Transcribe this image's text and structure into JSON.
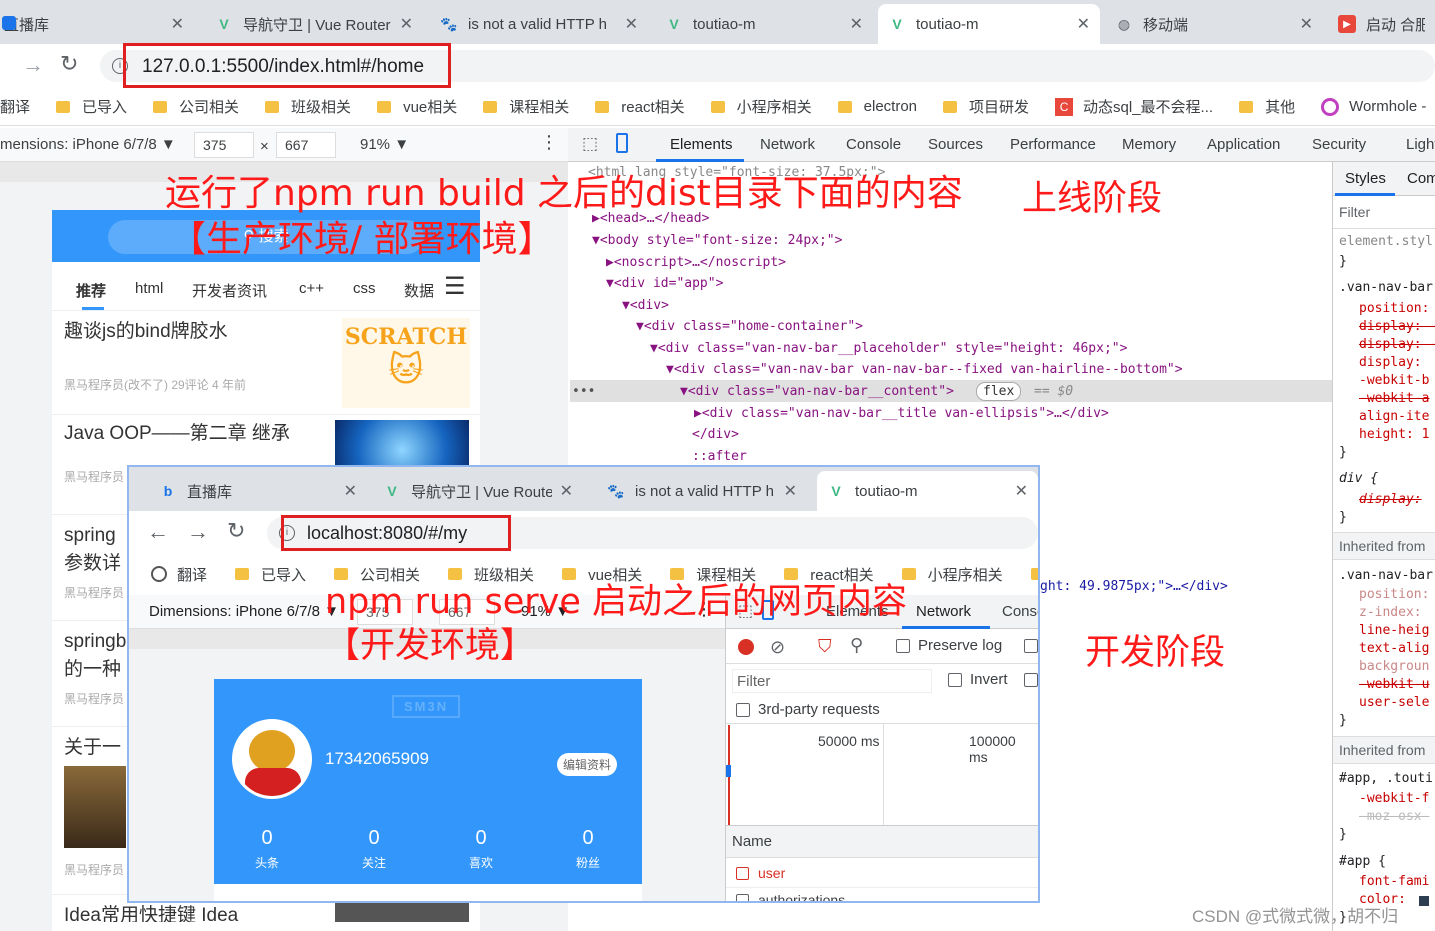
{
  "outer_browser": {
    "tabs": [
      {
        "title": "直播库",
        "icon": "bilibili-icon"
      },
      {
        "title": "导航守卫 | Vue Router",
        "icon": "vue-icon"
      },
      {
        "title": "is not a valid HTTP h",
        "icon": "baidu-icon"
      },
      {
        "title": "toutiao-m",
        "icon": "vue-icon"
      },
      {
        "title": "toutiao-m",
        "icon": "vue-icon"
      },
      {
        "title": "移动端",
        "icon": "globe-icon"
      },
      {
        "title": "启动 合肥",
        "icon": "video-icon"
      }
    ],
    "url": "127.0.0.1:5500/index.html#/home",
    "bookmarks": [
      "翻译",
      "已导入",
      "公司相关",
      "班级相关",
      "vue相关",
      "课程相关",
      "react相关",
      "小程序相关",
      "electron",
      "项目研发",
      "动态sql_最不会程...",
      "其他",
      "Wormhole -"
    ],
    "device_bar": {
      "device": "mensions: iPhone 6/7/8 ▼",
      "width": "375",
      "x": "×",
      "height": "667",
      "zoom": "91% ▼"
    },
    "devtools_tabs": [
      "Elements",
      "Network",
      "Console",
      "Sources",
      "Performance",
      "Memory",
      "Application",
      "Security",
      "Lighth"
    ],
    "styles_tabs": [
      "Styles",
      "Com"
    ]
  },
  "outer_page": {
    "search_label": "搜索",
    "channels": [
      "推荐",
      "html",
      "开发者资讯",
      "c++",
      "css",
      "数据"
    ],
    "articles": [
      {
        "title": "趣谈js的bind牌胶水",
        "meta": "黑马程序员(改不了) 29评论 4 年前"
      },
      {
        "title": "Java OOP——第二章 继承",
        "meta": "黑马程序员"
      },
      {
        "title": "spring",
        "title2": "参数详",
        "meta": "黑马程序员"
      },
      {
        "title": "springb",
        "title2": "的一种",
        "meta": "黑马程序员"
      },
      {
        "title": "关于一",
        "meta": "黑马程序员"
      },
      {
        "title": "Idea常用快捷键 Idea"
      }
    ],
    "scratch_label": "SCRATCH"
  },
  "dom_tree": [
    "<html lang style=\"font-size: 37.5px;\">",
    "▶<head>…</head>",
    "▼<body style=\"font-size: 24px;\">",
    "▶<noscript>…</noscript>",
    "▼<div id=\"app\">",
    "▼<div>",
    "▼<div class=\"home-container\">",
    "▼<div class=\"van-nav-bar__placeholder\" style=\"height: 46px;\">",
    "▼<div class=\"van-nav-bar van-nav-bar--fixed van-hairline--bottom\">",
    "▼<div class=\"van-nav-bar__content\">",
    "▶<div class=\"van-nav-bar__title van-ellipsis\">…</div>",
    "</div>",
    "::after",
    "ght: 49.9875px;\">…</div>"
  ],
  "dom_badges": {
    "flex": "flex",
    "eq": "== $0",
    "dots": "•••"
  },
  "styles_lines": [
    "element.styl",
    "}",
    ".van-nav-bar",
    "position:",
    "display: -",
    "display: -",
    "display:",
    "-webkit-b",
    "-webkit-a",
    "align-ite",
    "height: 1",
    "}",
    "div {",
    "display:",
    "}",
    "Inherited from",
    ".van-nav-bar",
    "position:",
    "z-index:",
    "line-heig",
    "text-alig",
    "backgroun",
    "-webkit-u",
    "user-sele",
    "}",
    "Inherited from",
    "#app, .touti",
    "-webkit-f",
    "-moz-osx-",
    "}",
    "#app {",
    "font-fami",
    "color: ",
    "}"
  ],
  "styles_filter": "Filter",
  "inner_browser": {
    "tabs": [
      {
        "title": "直播库",
        "icon": "bilibili-icon"
      },
      {
        "title": "导航守卫 | Vue Route",
        "icon": "vue-icon"
      },
      {
        "title": "is not a valid HTTP h",
        "icon": "baidu-icon"
      },
      {
        "title": "toutiao-m",
        "icon": "vue-icon"
      }
    ],
    "url": "localhost:8080/#/my",
    "bookmarks": [
      "翻译",
      "已导入",
      "公司相关",
      "班级相关",
      "vue相关",
      "课程相关",
      "react相关",
      "小程序相关",
      "e"
    ],
    "device_bar": {
      "device": "Dimensions: iPhone 6/7/8 ▼",
      "width": "375",
      "height": "667",
      "zoom": "91% ▼"
    },
    "devtools_tabs": [
      "Elements",
      "Network",
      "Conso"
    ],
    "network": {
      "preserve_log": "Preserve log",
      "filter": "Filter",
      "invert": "Invert",
      "third_party": "3rd-party requests",
      "t1": "50000 ms",
      "t2": "100000 ms",
      "name_header": "Name",
      "rows": [
        "user",
        "authorizations"
      ]
    },
    "profile": {
      "phone": "17342065909",
      "edit": "编辑资料",
      "watermark": "SM3N",
      "stats": [
        {
          "n": "0",
          "l": "头条"
        },
        {
          "n": "0",
          "l": "关注"
        },
        {
          "n": "0",
          "l": "喜欢"
        },
        {
          "n": "0",
          "l": "粉丝"
        }
      ]
    }
  },
  "annotations": {
    "build_line1": "运行了npm run build 之后的dist目录下面的内容",
    "build_line2": "【生产环境/ 部署环境】",
    "online": "上线阶段",
    "serve_line1": "npm run serve 启动之后的网页内容",
    "serve_line2": "【开发环境】",
    "dev": "开发阶段"
  },
  "watermark": "CSDN @式微式微，胡不归"
}
